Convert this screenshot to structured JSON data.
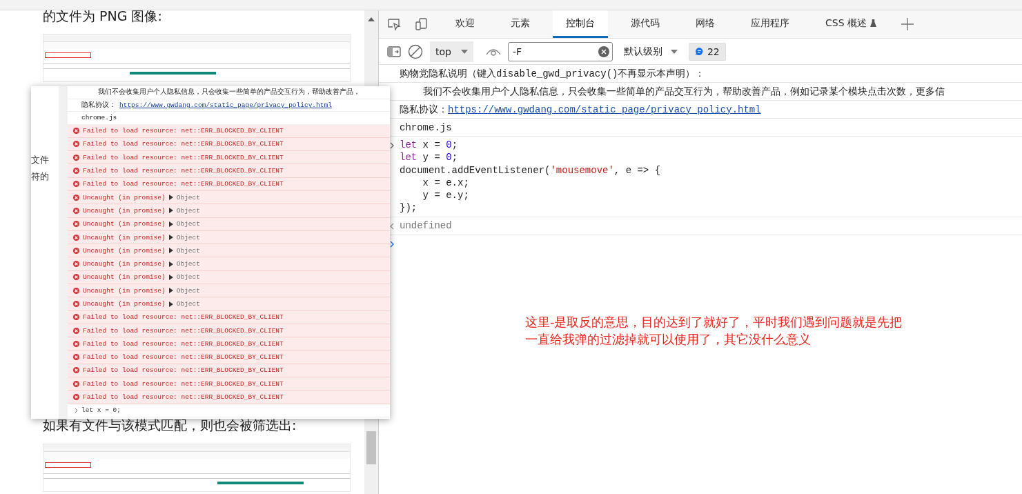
{
  "article": {
    "heading": "的文件为 PNG 图像:",
    "paragraph": "如果有文件与该模式匹配，则也会被筛选出:"
  },
  "popup": {
    "side_fragments": [
      "文件",
      "符的"
    ],
    "messages": [
      {
        "kind": "indent",
        "text": "我们不会收集用户个人隐私信息，只会收集一些简单的产品交互行为，帮助改善产品，"
      },
      {
        "kind": "link",
        "label": "隐私协议：",
        "url": "https://www.gwdang.com/static_page/privacy_policy.html"
      },
      {
        "kind": "info",
        "text": "chrome.js"
      },
      {
        "kind": "error",
        "text": "Failed to load resource: net::ERR_BLOCKED_BY_CLIENT"
      },
      {
        "kind": "error",
        "text": "Failed to load resource: net::ERR_BLOCKED_BY_CLIENT"
      },
      {
        "kind": "error",
        "text": "Failed to load resource: net::ERR_BLOCKED_BY_CLIENT"
      },
      {
        "kind": "error",
        "text": "Failed to load resource: net::ERR_BLOCKED_BY_CLIENT"
      },
      {
        "kind": "error",
        "text": "Failed to load resource: net::ERR_BLOCKED_BY_CLIENT"
      },
      {
        "kind": "error",
        "text": "Uncaught (in promise)",
        "object": "Object"
      },
      {
        "kind": "error",
        "text": "Uncaught (in promise)",
        "object": "Object"
      },
      {
        "kind": "error",
        "text": "Uncaught (in promise)",
        "object": "Object"
      },
      {
        "kind": "error",
        "text": "Uncaught (in promise)",
        "object": "Object"
      },
      {
        "kind": "error",
        "text": "Uncaught (in promise)",
        "object": "Object"
      },
      {
        "kind": "error",
        "text": "Uncaught (in promise)",
        "object": "Object"
      },
      {
        "kind": "error",
        "text": "Uncaught (in promise)",
        "object": "Object"
      },
      {
        "kind": "error",
        "text": "Uncaught (in promise)",
        "object": "Object"
      },
      {
        "kind": "error",
        "text": "Uncaught (in promise)",
        "object": "Object"
      },
      {
        "kind": "error",
        "text": "Failed to load resource: net::ERR_BLOCKED_BY_CLIENT"
      },
      {
        "kind": "error",
        "text": "Failed to load resource: net::ERR_BLOCKED_BY_CLIENT"
      },
      {
        "kind": "error",
        "text": "Failed to load resource: net::ERR_BLOCKED_BY_CLIENT"
      },
      {
        "kind": "error",
        "text": "Failed to load resource: net::ERR_BLOCKED_BY_CLIENT"
      },
      {
        "kind": "error",
        "text": "Failed to load resource: net::ERR_BLOCKED_BY_CLIENT"
      },
      {
        "kind": "error",
        "text": "Failed to load resource: net::ERR_BLOCKED_BY_CLIENT"
      },
      {
        "kind": "error",
        "text": "Failed to load resource: net::ERR_BLOCKED_BY_CLIENT"
      }
    ],
    "prompt": "let x = 0;"
  },
  "devtools": {
    "tabs": [
      {
        "label": "欢迎",
        "selected": false
      },
      {
        "label": "元素",
        "selected": false
      },
      {
        "label": "控制台",
        "selected": true
      },
      {
        "label": "源代码",
        "selected": false
      },
      {
        "label": "网络",
        "selected": false
      },
      {
        "label": "应用程序",
        "selected": false
      },
      {
        "label": "CSS 概述",
        "selected": false,
        "experimental": true
      }
    ],
    "context": "top",
    "filter": "-F",
    "level": "默认级别",
    "badge": "22",
    "messages": [
      {
        "kind": "info",
        "text": "购物党隐私说明（键入disable_gwd_privacy()不再显示本声明）："
      },
      {
        "kind": "indent",
        "text": "我们不会收集用户个人隐私信息，只会收集一些简单的产品交互行为，帮助改善产品，例如记录某个模块点击次数，更多信"
      },
      {
        "kind": "link",
        "label": "隐私协议：",
        "url": "https://www.gwdang.com/static_page/privacy_policy.html"
      },
      {
        "kind": "info",
        "text": "chrome.js"
      },
      {
        "kind": "input",
        "lines": [
          [
            {
              "kind": "kw",
              "s": "let"
            },
            {
              "kind": "plain",
              "s": " x = "
            },
            {
              "kind": "num",
              "s": "0"
            },
            {
              "kind": "plain",
              "s": ";"
            }
          ],
          [
            {
              "kind": "kw",
              "s": "let"
            },
            {
              "kind": "plain",
              "s": " y = "
            },
            {
              "kind": "num",
              "s": "0"
            },
            {
              "kind": "plain",
              "s": ";"
            }
          ],
          [
            {
              "kind": "plain",
              "s": "document.addEventListener("
            },
            {
              "kind": "str",
              "s": "'mousemove'"
            },
            {
              "kind": "plain",
              "s": ", e => {"
            }
          ],
          [
            {
              "kind": "plain",
              "s": "    x = e.x;"
            }
          ],
          [
            {
              "kind": "plain",
              "s": "    y = e.y;"
            }
          ],
          [
            {
              "kind": "plain",
              "s": "});"
            }
          ]
        ]
      },
      {
        "kind": "result",
        "text": "undefined"
      }
    ],
    "annotation": [
      "这里-是取反的意思，目的达到了就好了，平时我们遇到问题就是先把",
      "一直给我弹的过滤掉就可以使用了，其它没什么意义"
    ]
  }
}
